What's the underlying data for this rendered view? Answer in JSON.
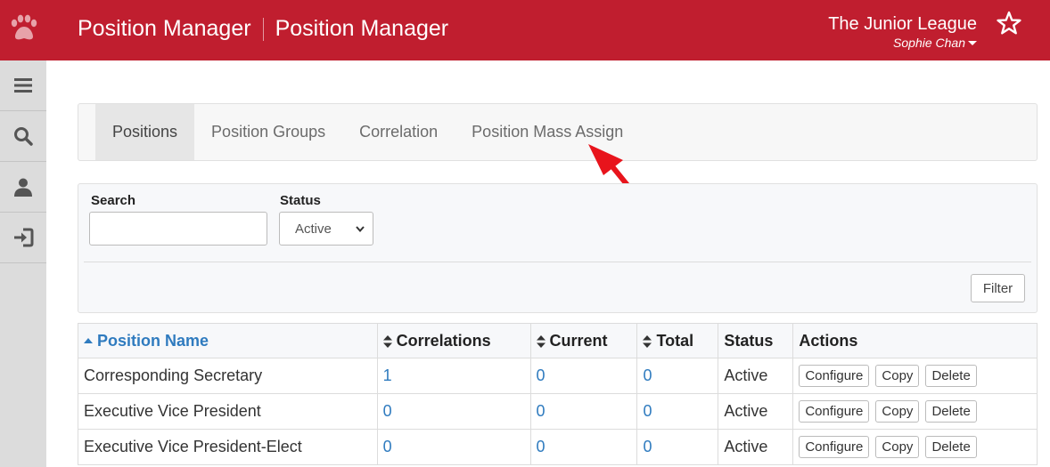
{
  "header": {
    "app_title": "Position Manager",
    "page_title": "Position Manager",
    "org_name": "The Junior League",
    "user_name": "Sophie Chan"
  },
  "sidebar": {
    "items": [
      {
        "icon": "menu-icon"
      },
      {
        "icon": "search-icon"
      },
      {
        "icon": "user-icon"
      },
      {
        "icon": "login-icon"
      }
    ]
  },
  "tabs": [
    {
      "label": "Positions",
      "active": true
    },
    {
      "label": "Position Groups",
      "active": false
    },
    {
      "label": "Correlation",
      "active": false
    },
    {
      "label": "Position Mass Assign",
      "active": false
    }
  ],
  "filter": {
    "search_label": "Search",
    "search_value": "",
    "status_label": "Status",
    "status_value": "Active",
    "filter_button": "Filter"
  },
  "table": {
    "columns": [
      "Position Name",
      "Correlations",
      "Current",
      "Total",
      "Status",
      "Actions"
    ],
    "rows": [
      {
        "name": "Corresponding Secretary",
        "correlations": "1",
        "current": "0",
        "total": "0",
        "status": "Active"
      },
      {
        "name": "Executive Vice President",
        "correlations": "0",
        "current": "0",
        "total": "0",
        "status": "Active"
      },
      {
        "name": "Executive Vice President-Elect",
        "correlations": "0",
        "current": "0",
        "total": "0",
        "status": "Active"
      }
    ],
    "actions": {
      "configure": "Configure",
      "copy": "Copy",
      "delete": "Delete"
    }
  },
  "colors": {
    "brand_red": "#c01e2f",
    "link_blue": "#2f7bbf",
    "annotation_arrow": "#e8141c"
  }
}
